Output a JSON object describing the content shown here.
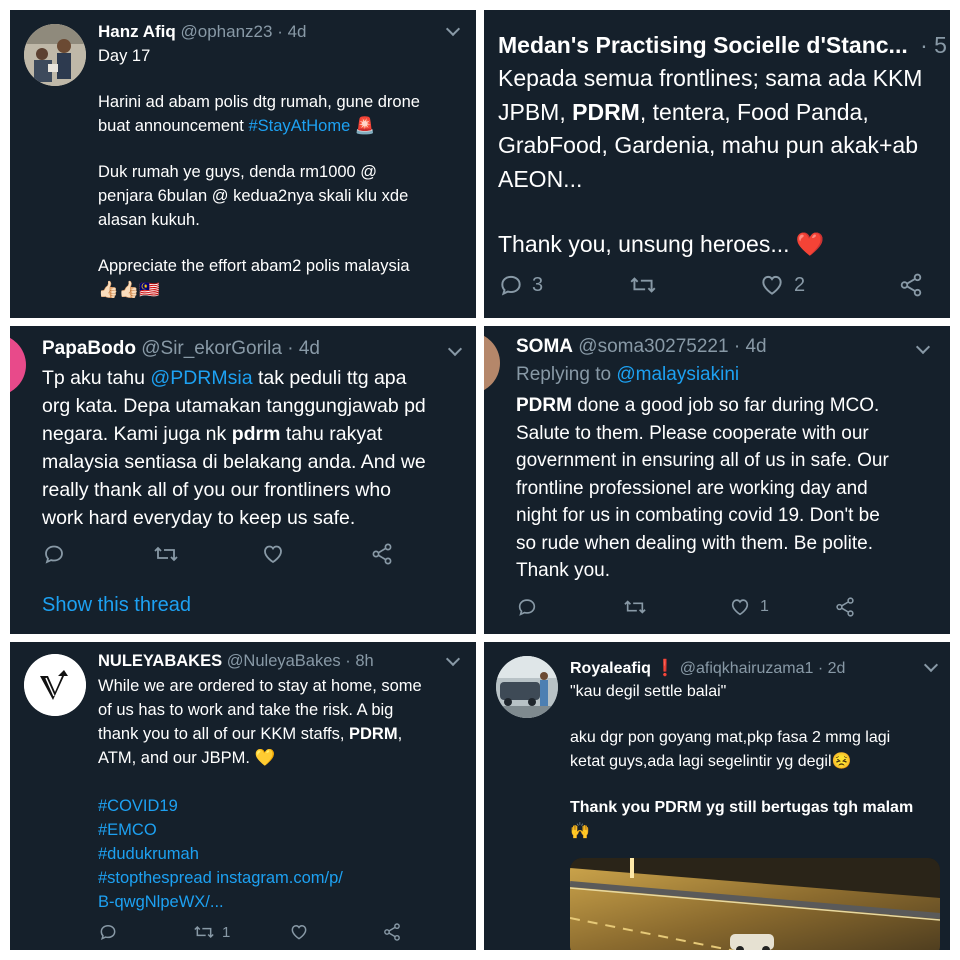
{
  "tweets": [
    {
      "name": "Hanz Afiq",
      "handle": "@ophanz23",
      "time": "· 4d",
      "lines": {
        "l1": "Day 17",
        "l2": "Harini ad abam polis dtg rumah, gune drone",
        "l3a": "buat announcement ",
        "l3b": "#StayAtHome",
        "l3c": " 🚨",
        "l4": "Duk rumah ye guys, denda rm1000 @",
        "l5": "penjara 6bulan @ kedua2nya skali klu xde",
        "l6": "alasan kukuh.",
        "l7": "Appreciate the effort abam2 polis malaysia",
        "l8": "👍🏻👍🏻🇲🇾"
      }
    },
    {
      "name": "Medan's Practising Socielle d'Stanc...",
      "time": "· 5",
      "lines": {
        "l1": "Kepada semua frontlines; sama ada KKM",
        "l2a": "JPBM, ",
        "l2b": "PDRM",
        "l2c": ", tentera, Food Panda,",
        "l3": "GrabFood, Gardenia, mahu pun akak+ab",
        "l4": "AEON...",
        "l5": "Thank you, unsung heroes... ❤️"
      },
      "replies": "3",
      "likes": "2"
    },
    {
      "name": "PapaBodo",
      "handle": "@Sir_ekorGorila",
      "time": "· 4d",
      "lines": {
        "l1a": "Tp aku tahu ",
        "l1b": "@PDRMsia",
        "l1c": " tak peduli ttg apa",
        "l2": "org kata. Depa utamakan tanggungjawab pd",
        "l3a": "negara. Kami juga nk ",
        "l3b": "pdrm",
        "l3c": " tahu rakyat",
        "l4": "malaysia sentiasa di belakang anda. And we",
        "l5": "really thank all of you our frontliners who",
        "l6": "work hard everyday to keep us safe."
      },
      "show_thread": "Show this thread"
    },
    {
      "name": "SOMA",
      "handle": "@soma30275221",
      "time": "· 4d",
      "replying_to": "Replying to ",
      "replying_handle": "@malaysiakini",
      "lines": {
        "l1a": "PDRM",
        "l1b": " done a good job so far during MCO.",
        "l2": "Salute to them.  Please cooperate with our",
        "l3": "government in ensuring all of us in safe. Our",
        "l4": "frontline professionel are working day and",
        "l5": "night for us in combating covid 19. Don't be",
        "l6": "so rude when dealing with them. Be polite.",
        "l7": "Thank you."
      },
      "likes": "1"
    },
    {
      "name": "NULEYABAKES",
      "handle": "@NuleyaBakes",
      "time": "· 8h",
      "lines": {
        "l1": "While we are ordered to stay at home, some",
        "l2": "of us has to work and take the risk. A big",
        "l3a": "thank you to all of our KKM staffs, ",
        "l3b": "PDRM",
        "l3c": ",",
        "l4": "ATM, and our JBPM. 💛",
        "h1": "#COVID19",
        "h2": "#EMCO",
        "h3": "#dudukrumah",
        "h4": "#stopthespread instagram.com/p/",
        "h5": "B-qwgNlpeWX/..."
      },
      "retweets": "1"
    },
    {
      "name": "Royaleafiq ❗",
      "handle": "@afiqkhairuzama1",
      "time": "· 2d",
      "lines": {
        "l1": "\"kau degil settle balai\"",
        "l2": "aku dgr pon goyang mat,pkp fasa 2 mmg lagi",
        "l3": "ketat guys,ada lagi segelintir yg degil😣",
        "l4a": "Thank you ",
        "l4b": "PDRM",
        "l4c": " yg still bertugas tgh malam",
        "l5": "🙌"
      }
    }
  ],
  "colors": {
    "bg": "#15202b",
    "text": "#ffffff",
    "muted": "#8899a6",
    "link": "#1da1f2",
    "heart": "#e0245e"
  }
}
